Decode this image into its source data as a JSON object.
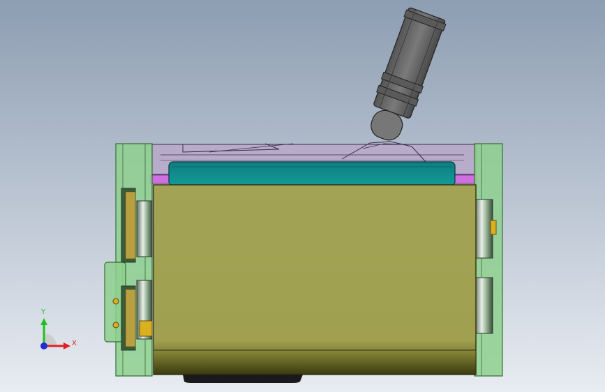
{
  "viewport": {
    "background_top": "#8d9db2",
    "background_bottom": "#e8ecf2"
  },
  "triad": {
    "x_label": "X",
    "y_label": "Y",
    "x_color": "#e02020",
    "y_color": "#20c020",
    "z_color": "#2030d0"
  },
  "colors": {
    "frame_green": "#8fd08f",
    "frame_green_dark": "#2f6f2f",
    "cover_pink": "#b8a6c8",
    "strip_magenta": "#d070e0",
    "body_olive": "#a0a050",
    "body_olive_dark": "#5a5a20",
    "teal_block": "#108c8c",
    "motor_gray": "#6a6a6a",
    "base_black": "#1a1a1a"
  }
}
